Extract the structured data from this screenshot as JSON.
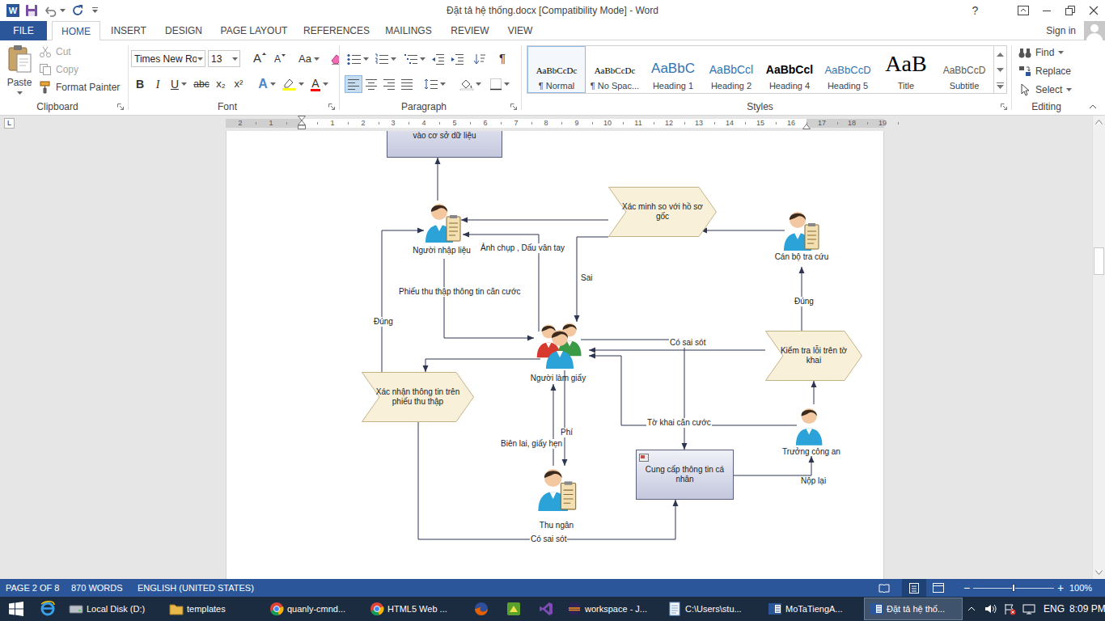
{
  "window": {
    "app_icon": "W",
    "title": "Đặt tả hệ thống.docx [Compatibility Mode] - Word",
    "help": "?"
  },
  "ribbon": {
    "file_tab": "FILE",
    "tabs": [
      {
        "label": "HOME",
        "selected": true
      },
      {
        "label": "INSERT",
        "selected": false
      },
      {
        "label": "DESIGN",
        "selected": false
      },
      {
        "label": "PAGE LAYOUT",
        "selected": false
      },
      {
        "label": "REFERENCES",
        "selected": false
      },
      {
        "label": "MAILINGS",
        "selected": false
      },
      {
        "label": "REVIEW",
        "selected": false
      },
      {
        "label": "VIEW",
        "selected": false
      }
    ],
    "account": "Sign in",
    "clipboard": {
      "label": "Clipboard",
      "paste": "Paste",
      "items": [
        {
          "label": "Cut",
          "disabled": true
        },
        {
          "label": "Copy",
          "disabled": true
        },
        {
          "label": "Format Painter",
          "disabled": false
        }
      ]
    },
    "font": {
      "label": "Font",
      "family": "Times New Ro",
      "size": "13",
      "grow": "A",
      "shrink": "A",
      "change_case": "Aa",
      "bold": "B",
      "italic": "I",
      "underline": "U",
      "strikethrough": "abc",
      "subscript": "x₂",
      "superscript": "x²",
      "text_effects": "A",
      "font_color": "A"
    },
    "paragraph": {
      "label": "Paragraph",
      "show_marks": "¶",
      "alignments": [
        {
          "selected": true
        },
        {
          "selected": false
        },
        {
          "selected": false
        },
        {
          "selected": false
        }
      ]
    },
    "styles": {
      "label": "Styles",
      "items": [
        {
          "preview": "AaBbCcDc",
          "name": "¶ Normal",
          "selected": true
        },
        {
          "preview": "AaBbCcDc",
          "name": "¶ No Spac...",
          "selected": false
        },
        {
          "preview": "AaBbC",
          "name": "Heading 1",
          "selected": false
        },
        {
          "preview": "AaBbCcl",
          "name": "Heading 2",
          "selected": false
        },
        {
          "preview": "AaBbCcl",
          "name": "Heading 4",
          "selected": false
        },
        {
          "preview": "AaBbCcD",
          "name": "Heading 5",
          "selected": false
        },
        {
          "preview": "AaB",
          "name": "Title",
          "selected": false
        },
        {
          "preview": "AaBbCcD",
          "name": "Subtitle",
          "selected": false
        }
      ]
    },
    "editing": {
      "label": "Editing",
      "find": "Find",
      "replace": "Replace",
      "select": "Select"
    }
  },
  "ruler": {
    "corner": "L",
    "left_numbers": [
      "2",
      "1"
    ],
    "numbers": [
      "1",
      "2",
      "3",
      "4",
      "5",
      "6",
      "7",
      "8",
      "9",
      "10",
      "11",
      "12",
      "13",
      "14",
      "15",
      "16",
      "17",
      "18",
      "19"
    ]
  },
  "document": {
    "diagram": {
      "nodes": [
        {
          "label": "vào cơ sở dữ liệu",
          "kind": "process"
        },
        {
          "label": "Người nhập liệu",
          "kind": "clerk"
        },
        {
          "label": "Xác minh so với hồ sơ gốc",
          "kind": "decision"
        },
        {
          "label": "Cán bộ tra cứu",
          "kind": "clerk"
        },
        {
          "label": "Người làm giấy",
          "kind": "group"
        },
        {
          "label": "Kiểm tra lỗi trên tờ khai",
          "kind": "decision"
        },
        {
          "label": "Xác nhận thông tin trên phiếu thu thập",
          "kind": "decision"
        },
        {
          "label": "Trưởng công an",
          "kind": "person"
        },
        {
          "label": "Cung cấp thông tin cá nhân",
          "kind": "process"
        },
        {
          "label": "Thu ngân",
          "kind": "clerk"
        }
      ],
      "edge_labels": [
        "Ảnh chụp , Dấu vân tay",
        "Phiếu thu thập thông tin căn cước",
        "Sai",
        "Đúng",
        "Đúng",
        "Có sai sót",
        "Tờ khai căn cước",
        "Phí",
        "Biên lai, giấy hẹn",
        "Nộp lại",
        "Có sai sót"
      ]
    },
    "vertical_scroll": {
      "level": 0.29
    }
  },
  "status_bar": {
    "page": "PAGE 2 OF 8",
    "words": "870 WORDS",
    "language": "ENGLISH (UNITED STATES)",
    "views": [
      {
        "selected": false
      },
      {
        "selected": true
      },
      {
        "selected": false
      }
    ],
    "zoom": {
      "minus": "−",
      "plus": "+",
      "level": 0.5,
      "reading": "100%"
    }
  },
  "taskbar": {
    "items": [
      {
        "kind": "icon",
        "selected": false
      },
      {
        "kind": "window",
        "label": "Local Disk (D:)",
        "selected": false
      },
      {
        "kind": "window",
        "label": "templates",
        "selected": false
      },
      {
        "kind": "window",
        "label": "quanly-cmnd...",
        "selected": false
      },
      {
        "kind": "window",
        "label": "HTML5 Web ...",
        "selected": false
      },
      {
        "kind": "icon",
        "selected": false
      },
      {
        "kind": "icon",
        "selected": false
      },
      {
        "kind": "icon",
        "selected": false
      },
      {
        "kind": "window",
        "label": "workspace - J...",
        "selected": false
      },
      {
        "kind": "window",
        "label": "C:\\Users\\stu...",
        "selected": false
      },
      {
        "kind": "window",
        "label": "MoTaTiengA...",
        "selected": false
      },
      {
        "kind": "window",
        "label": "Đặt tả hệ thố...",
        "selected": true
      }
    ],
    "tray": {
      "language": "ENG",
      "time": "8:09 PM"
    }
  }
}
